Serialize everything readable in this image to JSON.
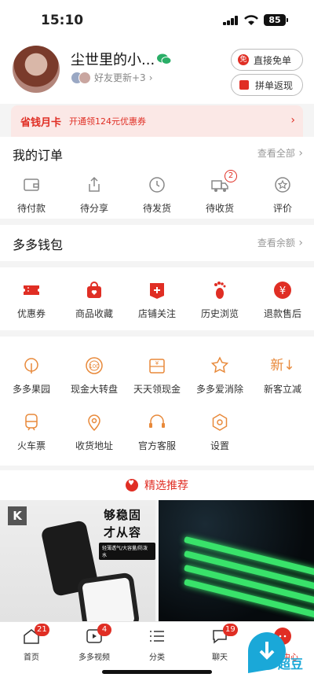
{
  "status_bar": {
    "time": "15:10",
    "battery": "85"
  },
  "profile": {
    "username": "尘世里的小...",
    "friends_update": "好友更新+3",
    "btn_free_order": "直接免单",
    "btn_free_badge": "免",
    "btn_group_cashback": "拼单返现"
  },
  "banner": {
    "title": "省钱月卡",
    "subtitle": "开通领124元优惠券"
  },
  "orders": {
    "title": "我的订单",
    "more": "查看全部",
    "items": [
      {
        "label": "待付款",
        "icon": "wallet-icon"
      },
      {
        "label": "待分享",
        "icon": "share-icon"
      },
      {
        "label": "待发货",
        "icon": "clock-icon"
      },
      {
        "label": "待收货",
        "icon": "truck-icon",
        "badge": "2"
      },
      {
        "label": "评价",
        "icon": "review-icon"
      }
    ]
  },
  "wallet": {
    "title": "多多钱包",
    "more": "查看余额"
  },
  "quick": {
    "items": [
      {
        "label": "优惠券",
        "icon": "coupon-icon"
      },
      {
        "label": "商品收藏",
        "icon": "favorite-bag-icon"
      },
      {
        "label": "店铺关注",
        "icon": "store-follow-icon"
      },
      {
        "label": "历史浏览",
        "icon": "footprint-icon"
      },
      {
        "label": "退款售后",
        "icon": "refund-icon"
      }
    ]
  },
  "services": {
    "row1": [
      {
        "label": "多多果园",
        "icon": "tree-icon"
      },
      {
        "label": "现金大转盘",
        "icon": "wheel-icon"
      },
      {
        "label": "天天领现金",
        "icon": "cash-icon"
      },
      {
        "label": "多多爱消除",
        "icon": "star-game-icon"
      },
      {
        "label": "新客立减",
        "icon": "new-customer-icon",
        "text": "新↓"
      }
    ],
    "row2": [
      {
        "label": "火车票",
        "icon": "train-icon"
      },
      {
        "label": "收货地址",
        "icon": "location-icon"
      },
      {
        "label": "官方客服",
        "icon": "headset-icon"
      },
      {
        "label": "设置",
        "icon": "settings-icon"
      }
    ]
  },
  "recommend": {
    "title": "精选推荐"
  },
  "product1": {
    "slogan_line1": "够稳固",
    "slogan_line2": "才从容",
    "tag": "轻薄透气/大容量/防泼水",
    "brand_letter": "K"
  },
  "tabbar": [
    {
      "label": "首页",
      "badge": "21",
      "icon": "home-icon"
    },
    {
      "label": "多多视频",
      "badge": "4",
      "icon": "video-icon"
    },
    {
      "label": "分类",
      "icon": "category-icon"
    },
    {
      "label": "聊天",
      "badge": "19",
      "icon": "chat-icon"
    },
    {
      "label": "个人中心",
      "icon": "profile-icon"
    }
  ],
  "watermark": {
    "text": "超豆"
  },
  "colors": {
    "accent": "#e02e24",
    "orange": "#e8893a"
  }
}
